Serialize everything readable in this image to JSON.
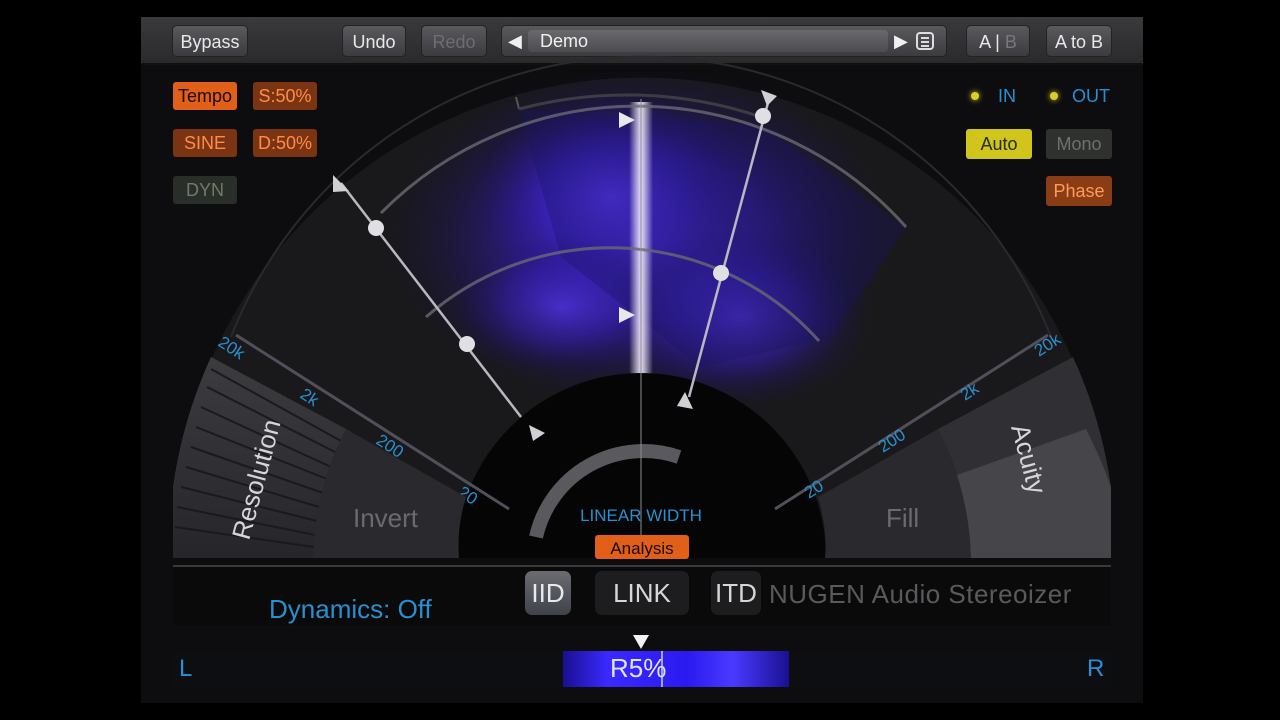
{
  "toolbar": {
    "bypass": "Bypass",
    "undo": "Undo",
    "redo": "Redo",
    "preset_name": "Demo",
    "ab_a": "A | ",
    "ab_b": "B",
    "a_to_b": "A to B"
  },
  "left_controls": {
    "tempo": "Tempo",
    "sync": "S:50%",
    "sine": "SINE",
    "depth": "D:50%",
    "dyn": "DYN"
  },
  "right_controls": {
    "in": "IN",
    "out": "OUT",
    "auto": "Auto",
    "mono": "Mono",
    "phase": "Phase"
  },
  "display": {
    "left_panel_resolution": "Resolution",
    "left_panel_invert": "Invert",
    "right_panel_fill": "Fill",
    "right_panel_acuity": "Acuity",
    "left_scale": [
      "20k",
      "2k",
      "200",
      "20"
    ],
    "right_scale": [
      "20",
      "200",
      "2k",
      "20k"
    ],
    "center_label": "LINEAR WIDTH",
    "analysis": "Analysis"
  },
  "status": {
    "dynamics": "Dynamics:  Off",
    "iid": "IID",
    "link": "LINK",
    "itd": "ITD",
    "brand": "NUGEN Audio Stereoizer"
  },
  "meter": {
    "left": "L",
    "right": "R",
    "value": "R5%",
    "position_fraction": 0.52
  },
  "colors": {
    "accent_blue": "#2a8fd0",
    "orange": "#e0601a",
    "yellow": "#cfc51c",
    "meter_blue": "#3a2aff"
  }
}
